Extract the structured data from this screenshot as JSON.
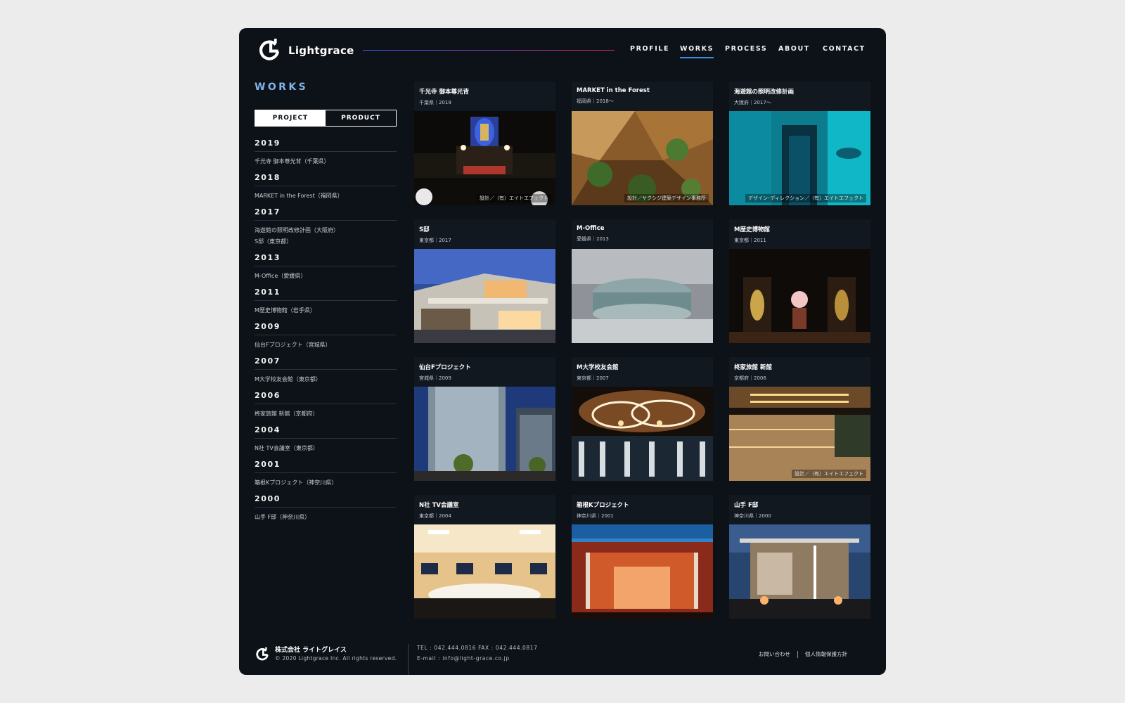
{
  "brand": {
    "name": "Lightgrace",
    "accent": "#82b4ea",
    "nav_underline": "#3d8fe4"
  },
  "nav": {
    "items": [
      {
        "label": "PROFILE"
      },
      {
        "label": "WORKS",
        "active": true
      },
      {
        "label": "PROCESS"
      },
      {
        "label": "ABOUT"
      },
      {
        "label": "CONTACT"
      }
    ]
  },
  "sidebar": {
    "title": "WORKS",
    "tabs": [
      {
        "label": "PROJECT",
        "active": true
      },
      {
        "label": "PRODUCT",
        "active": false
      }
    ],
    "years": [
      {
        "year": "2019",
        "items": [
          "千光寺 御本尊光背（千葉県）"
        ]
      },
      {
        "year": "2018",
        "items": [
          "MARKET in the Forest（福岡県）"
        ]
      },
      {
        "year": "2017",
        "items": [
          "海遊館の照明改修計画（大阪府）",
          "S邸（東京都）"
        ]
      },
      {
        "year": "2013",
        "items": [
          "M-Office（愛媛県）"
        ]
      },
      {
        "year": "2011",
        "items": [
          "M歴史博物館（岩手県）"
        ]
      },
      {
        "year": "2009",
        "items": [
          "仙台Fプロジェクト（宮城県）"
        ]
      },
      {
        "year": "2007",
        "items": [
          "M大学校友会館（東京都）"
        ]
      },
      {
        "year": "2006",
        "items": [
          "柊家旅館 新館（京都府）"
        ]
      },
      {
        "year": "2004",
        "items": [
          "N社 TV会議室（東京都）"
        ]
      },
      {
        "year": "2001",
        "items": [
          "箱根Kプロジェクト（神奈川県）"
        ]
      },
      {
        "year": "2000",
        "items": [
          "山手 F邸（神奈川県）"
        ]
      }
    ]
  },
  "works": [
    {
      "title": "千光寺 御本尊光背",
      "meta": "千葉県｜2019",
      "credit": "設計／（有）エイトエフェクト",
      "theme": "temple"
    },
    {
      "title": "MARKET in the Forest",
      "meta": "福岡県｜2018〜",
      "credit": "設計／ヤクシジ建築デザイン事務所",
      "theme": "forest"
    },
    {
      "title": "海遊館の照明改修計画",
      "meta": "大阪府｜2017〜",
      "credit": "デザイン･ディレクション／（有）エイトエフェクト",
      "theme": "aquarium"
    },
    {
      "title": "S邸",
      "meta": "東京都｜2017",
      "credit": "",
      "theme": "house"
    },
    {
      "title": "M-Office",
      "meta": "愛媛県｜2013",
      "credit": "",
      "theme": "office"
    },
    {
      "title": "M歴史博物館",
      "meta": "東京都｜2011",
      "credit": "",
      "theme": "museum"
    },
    {
      "title": "仙台Fプロジェクト",
      "meta": "宮城県｜2009",
      "credit": "",
      "theme": "building"
    },
    {
      "title": "M大学校友会館",
      "meta": "東京都｜2007",
      "credit": "",
      "theme": "hall"
    },
    {
      "title": "柊家旅館 新館",
      "meta": "京都府｜2006",
      "credit": "設計／（有）エイトエフェクト",
      "theme": "ryokan"
    },
    {
      "title": "N社 TV会議室",
      "meta": "東京都｜2004",
      "credit": "",
      "theme": "conference"
    },
    {
      "title": "箱根Kプロジェクト",
      "meta": "神奈川県｜2001",
      "credit": "",
      "theme": "hakone"
    },
    {
      "title": "山手 F邸",
      "meta": "神奈川県｜2000",
      "credit": "",
      "theme": "villa"
    }
  ],
  "footer": {
    "company": "株式会社 ライトグレイス",
    "copyright": "© 2020 Lightgrace Inc. All rights reserved.",
    "tel": "TEL : 042.444.0816 FAX : 042.444.0817",
    "email": "E-mail : info@light-grace.co.jp",
    "links": [
      "お問い合わせ",
      "個人情報保護方針"
    ]
  }
}
